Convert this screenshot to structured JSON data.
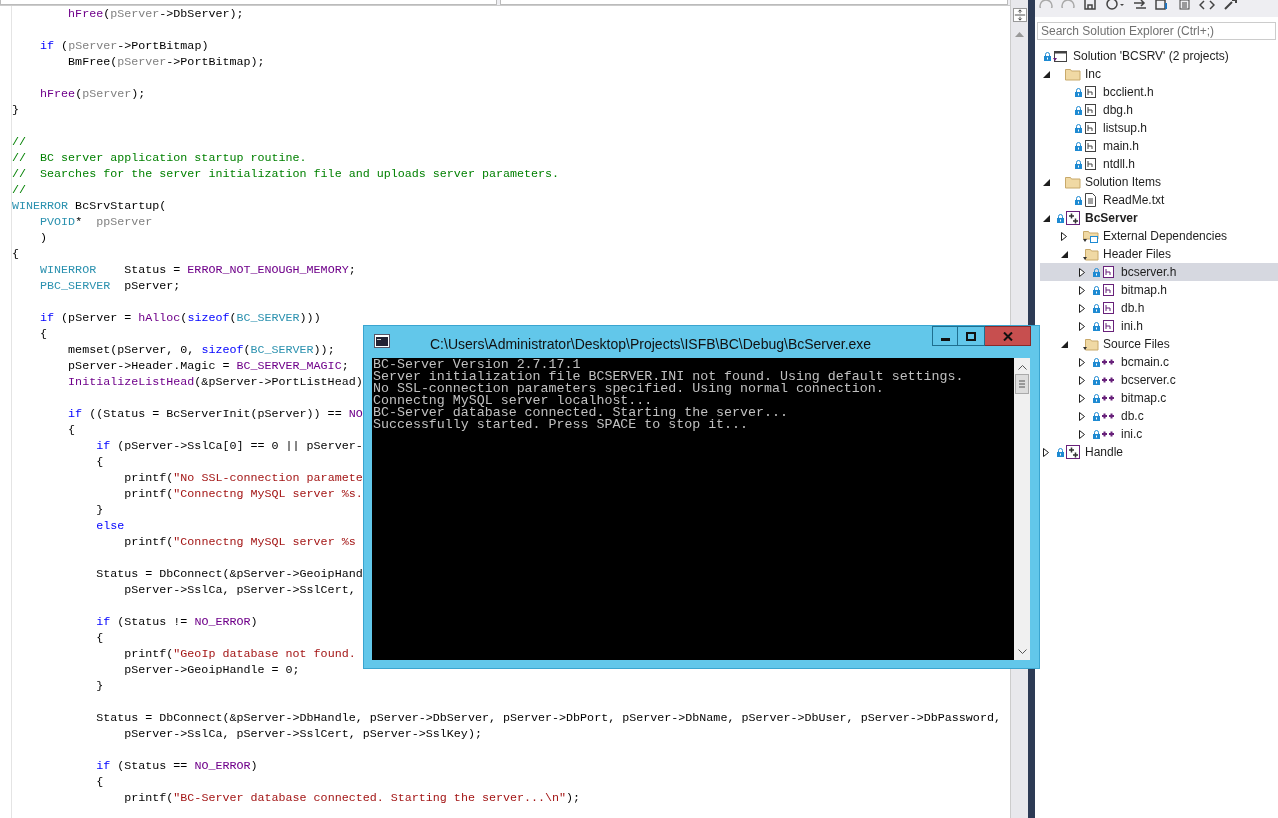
{
  "editor": {
    "blocks": [
      {
        "lines": [
          {
            "segments": [
              {
                "kind": "macro",
                "text": "        hFree"
              },
              {
                "kind": "plain",
                "text": "("
              },
              {
                "kind": "param",
                "text": "pServer"
              },
              {
                "kind": "plain",
                "text": "->DbServer);"
              }
            ]
          }
        ]
      },
      {
        "lines": [
          {
            "segments": [
              {
                "kind": "keyword",
                "text": "    if"
              },
              {
                "kind": "plain",
                "text": " ("
              },
              {
                "kind": "param",
                "text": "pServer"
              },
              {
                "kind": "plain",
                "text": "->PortBitmap)"
              }
            ]
          },
          {
            "segments": [
              {
                "kind": "plain",
                "text": "        BmFree("
              },
              {
                "kind": "param",
                "text": "pServer"
              },
              {
                "kind": "plain",
                "text": "->PortBitmap);"
              }
            ]
          }
        ]
      },
      {
        "lines": [
          {
            "segments": [
              {
                "kind": "macro",
                "text": "    hFree"
              },
              {
                "kind": "plain",
                "text": "("
              },
              {
                "kind": "param",
                "text": "pServer"
              },
              {
                "kind": "plain",
                "text": ");"
              }
            ]
          },
          {
            "segments": [
              {
                "kind": "plain",
                "text": "}"
              }
            ]
          }
        ]
      },
      {
        "lines": [
          {
            "segments": [
              {
                "kind": "comment",
                "text": "//"
              }
            ]
          },
          {
            "segments": [
              {
                "kind": "comment",
                "text": "//  BC server application startup routine."
              }
            ]
          },
          {
            "segments": [
              {
                "kind": "comment",
                "text": "//  Searches for the server initialization file and uploads server parameters."
              }
            ]
          },
          {
            "segments": [
              {
                "kind": "comment",
                "text": "//"
              }
            ]
          },
          {
            "segments": [
              {
                "kind": "type",
                "text": "WINERROR"
              },
              {
                "kind": "plain",
                "text": " BcSrvStartup("
              }
            ]
          },
          {
            "segments": [
              {
                "kind": "type",
                "text": "    PVOID"
              },
              {
                "kind": "plain",
                "text": "*  "
              },
              {
                "kind": "param",
                "text": "ppServer"
              }
            ]
          },
          {
            "segments": [
              {
                "kind": "plain",
                "text": "    )"
              }
            ]
          },
          {
            "segments": [
              {
                "kind": "plain",
                "text": "{"
              }
            ]
          },
          {
            "segments": [
              {
                "kind": "type",
                "text": "    WINERROR"
              },
              {
                "kind": "plain",
                "text": "    Status = "
              },
              {
                "kind": "macro",
                "text": "ERROR_NOT_ENOUGH_MEMORY"
              },
              {
                "kind": "plain",
                "text": ";"
              }
            ]
          },
          {
            "segments": [
              {
                "kind": "type",
                "text": "    PBC_SERVER"
              },
              {
                "kind": "plain",
                "text": "  pServer;"
              }
            ]
          }
        ]
      },
      {
        "lines": [
          {
            "segments": [
              {
                "kind": "keyword",
                "text": "    if"
              },
              {
                "kind": "plain",
                "text": " (pServer = "
              },
              {
                "kind": "macro",
                "text": "hAlloc"
              },
              {
                "kind": "plain",
                "text": "("
              },
              {
                "kind": "keyword",
                "text": "sizeof"
              },
              {
                "kind": "plain",
                "text": "("
              },
              {
                "kind": "type",
                "text": "BC_SERVER"
              },
              {
                "kind": "plain",
                "text": ")))"
              }
            ]
          },
          {
            "segments": [
              {
                "kind": "plain",
                "text": "    {"
              }
            ]
          },
          {
            "segments": [
              {
                "kind": "plain",
                "text": "        memset(pServer, 0, "
              },
              {
                "kind": "keyword",
                "text": "sizeof"
              },
              {
                "kind": "plain",
                "text": "("
              },
              {
                "kind": "type",
                "text": "BC_SERVER"
              },
              {
                "kind": "plain",
                "text": "));"
              }
            ]
          },
          {
            "segments": [
              {
                "kind": "plain",
                "text": "        pServer->Header.Magic = "
              },
              {
                "kind": "macro",
                "text": "BC_SERVER_MAGIC"
              },
              {
                "kind": "plain",
                "text": ";"
              }
            ]
          },
          {
            "segments": [
              {
                "kind": "macro",
                "text": "        InitializeListHead"
              },
              {
                "kind": "plain",
                "text": "(&pServer->PortListHead)"
              }
            ]
          }
        ]
      },
      {
        "lines": [
          {
            "segments": [
              {
                "kind": "keyword",
                "text": "        if"
              },
              {
                "kind": "plain",
                "text": " ((Status = BcServerInit(pServer)) == "
              },
              {
                "kind": "macro",
                "text": "NO"
              }
            ]
          },
          {
            "segments": [
              {
                "kind": "plain",
                "text": "        {"
              }
            ]
          },
          {
            "segments": [
              {
                "kind": "keyword",
                "text": "            if"
              },
              {
                "kind": "plain",
                "text": " (pServer->SslCa[0] == 0 || pServer-"
              }
            ]
          },
          {
            "segments": [
              {
                "kind": "plain",
                "text": "            {"
              }
            ]
          },
          {
            "segments": [
              {
                "kind": "plain",
                "text": "                printf("
              },
              {
                "kind": "string",
                "text": "\"No SSL-connection paramete"
              }
            ]
          },
          {
            "segments": [
              {
                "kind": "plain",
                "text": "                printf("
              },
              {
                "kind": "string",
                "text": "\"Connectng MySQL server %s."
              }
            ]
          },
          {
            "segments": [
              {
                "kind": "plain",
                "text": "            }"
              }
            ]
          },
          {
            "segments": [
              {
                "kind": "keyword",
                "text": "            else"
              }
            ]
          },
          {
            "segments": [
              {
                "kind": "plain",
                "text": "                printf("
              },
              {
                "kind": "string",
                "text": "\"Connectng MySQL server %s"
              }
            ]
          }
        ]
      },
      {
        "lines": [
          {
            "segments": [
              {
                "kind": "plain",
                "text": "            Status = DbConnect(&pServer->GeoipHand"
              }
            ]
          },
          {
            "segments": [
              {
                "kind": "plain",
                "text": "                pServer->SslCa, pServer->SslCert,"
              }
            ]
          }
        ]
      },
      {
        "lines": [
          {
            "segments": [
              {
                "kind": "keyword",
                "text": "            if"
              },
              {
                "kind": "plain",
                "text": " (Status != "
              },
              {
                "kind": "macro",
                "text": "NO_ERROR"
              },
              {
                "kind": "plain",
                "text": ")"
              }
            ]
          },
          {
            "segments": [
              {
                "kind": "plain",
                "text": "            {"
              }
            ]
          },
          {
            "segments": [
              {
                "kind": "plain",
                "text": "                printf("
              },
              {
                "kind": "string",
                "text": "\"GeoIp database not found."
              }
            ]
          },
          {
            "segments": [
              {
                "kind": "plain",
                "text": "                pServer->GeoipHandle = 0;"
              }
            ]
          },
          {
            "segments": [
              {
                "kind": "plain",
                "text": "            }"
              }
            ]
          }
        ]
      },
      {
        "lines": [
          {
            "segments": [
              {
                "kind": "plain",
                "text": "            Status = DbConnect(&pServer->DbHandle, pServer->DbServer, pServer->DbPort, pServer->DbName, pServer->DbUser, pServer->DbPassword,"
              }
            ]
          },
          {
            "segments": [
              {
                "kind": "plain",
                "text": "                pServer->SslCa, pServer->SslCert, pServer->SslKey);"
              }
            ]
          }
        ]
      },
      {
        "lines": [
          {
            "segments": [
              {
                "kind": "keyword",
                "text": "            if"
              },
              {
                "kind": "plain",
                "text": " (Status == "
              },
              {
                "kind": "macro",
                "text": "NO_ERROR"
              },
              {
                "kind": "plain",
                "text": ")"
              }
            ]
          },
          {
            "segments": [
              {
                "kind": "plain",
                "text": "            {"
              }
            ]
          },
          {
            "segments": [
              {
                "kind": "plain",
                "text": "                printf("
              },
              {
                "kind": "string",
                "text": "\"BC-Server database connected. Starting the server...\\n\""
              },
              {
                "kind": "plain",
                "text": ");"
              }
            ]
          }
        ]
      }
    ]
  },
  "console": {
    "title": "C:\\Users\\Administrator\\Desktop\\Projects\\ISFB\\BC\\Debug\\BcServer.exe",
    "lines": [
      "BC-Server Version 2.7.17.1",
      "Server initialization file BCSERVER.INI not found. Using default settings.",
      "No SSL-connection parameters specified. Using normal connection.",
      "Connectng MySQL server localhost...",
      "BC-Server database connected. Starting the server...",
      "Successfully started. Press SPACE to stop it..."
    ]
  },
  "solution_explorer": {
    "search": {
      "placeholder": "Search Solution Explorer (Ctrl+;)"
    },
    "solution": {
      "label": "Solution 'BCSRV' (2 projects)",
      "locked": true
    },
    "items": [
      {
        "label": "Inc",
        "kind": "folder",
        "locked": false,
        "expanded": true,
        "selected": false,
        "children": [
          {
            "label": "bcclient.h",
            "kind": "include",
            "locked": true,
            "selected": false
          },
          {
            "label": "dbg.h",
            "kind": "include",
            "locked": true,
            "selected": false
          },
          {
            "label": "listsup.h",
            "kind": "include",
            "locked": true,
            "selected": false
          },
          {
            "label": "main.h",
            "kind": "include",
            "locked": true,
            "selected": false
          },
          {
            "label": "ntdll.h",
            "kind": "include",
            "locked": true,
            "selected": false
          }
        ]
      },
      {
        "label": "Solution Items",
        "kind": "folder",
        "locked": false,
        "expanded": true,
        "selected": false,
        "children": [
          {
            "label": "ReadMe.txt",
            "kind": "text",
            "locked": true,
            "selected": false
          }
        ]
      },
      {
        "label": "BcServer",
        "kind": "project",
        "startup": true,
        "locked": true,
        "expanded": true,
        "selected": false,
        "children": [
          {
            "label": "External Dependencies",
            "kind": "dependencies",
            "locked": false,
            "expanded": false,
            "selected": false
          },
          {
            "label": "Header Files",
            "kind": "filter",
            "locked": false,
            "expanded": true,
            "selected": false,
            "children": [
              {
                "label": "bcserver.h",
                "kind": "header",
                "locked": true,
                "expanded": false,
                "selected": true
              },
              {
                "label": "bitmap.h",
                "kind": "header",
                "locked": true,
                "expanded": false,
                "selected": false
              },
              {
                "label": "db.h",
                "kind": "header",
                "locked": true,
                "expanded": false,
                "selected": false
              },
              {
                "label": "ini.h",
                "kind": "header",
                "locked": true,
                "expanded": false,
                "selected": false
              }
            ]
          },
          {
            "label": "Source Files",
            "kind": "filter",
            "locked": false,
            "expanded": true,
            "selected": false,
            "children": [
              {
                "label": "bcmain.c",
                "kind": "source",
                "locked": true,
                "expanded": false,
                "selected": false
              },
              {
                "label": "bcserver.c",
                "kind": "source",
                "locked": true,
                "expanded": false,
                "selected": false
              },
              {
                "label": "bitmap.c",
                "kind": "source",
                "locked": true,
                "expanded": false,
                "selected": false
              },
              {
                "label": "db.c",
                "kind": "source",
                "locked": true,
                "expanded": false,
                "selected": false
              },
              {
                "label": "ini.c",
                "kind": "source",
                "locked": true,
                "expanded": false,
                "selected": false
              }
            ]
          }
        ]
      },
      {
        "label": "Handle",
        "kind": "project",
        "startup": false,
        "locked": true,
        "expanded": false,
        "selected": false
      }
    ]
  }
}
